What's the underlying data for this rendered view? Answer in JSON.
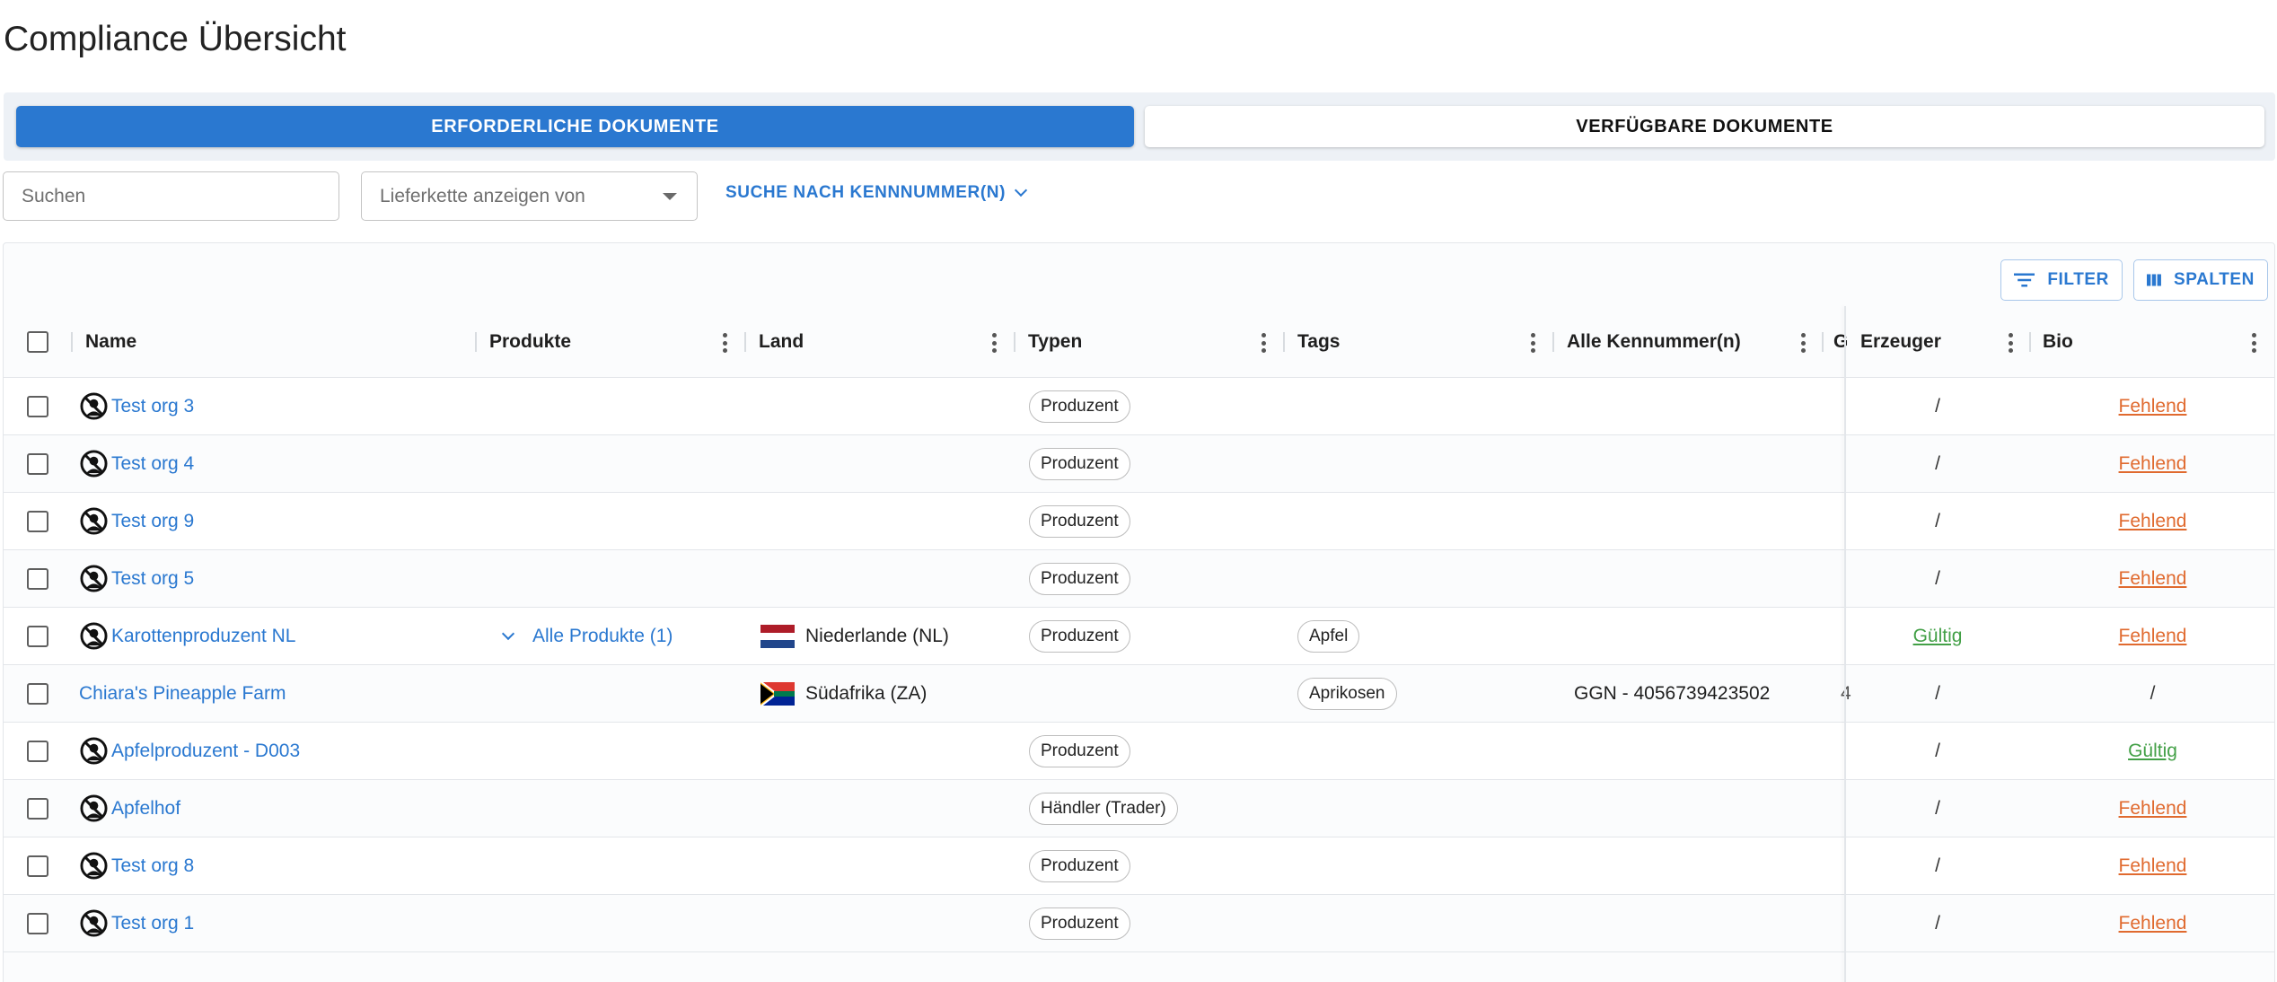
{
  "page": {
    "title": "Compliance Übersicht"
  },
  "tabs": {
    "required": "ERFORDERLICHE DOKUMENTE",
    "available": "VERFÜGBARE DOKUMENTE"
  },
  "filters": {
    "search_placeholder": "Suchen",
    "supply_chain_placeholder": "Lieferkette anzeigen von",
    "id_search_label": "SUCHE NACH KENNNUMMER(N)"
  },
  "toolbar": {
    "filter_label": "FILTER",
    "columns_label": "SPALTEN"
  },
  "columns": {
    "name": "Name",
    "products": "Produkte",
    "country": "Land",
    "types": "Typen",
    "tags": "Tags",
    "ids": "Alle Kennummer(n)",
    "truncated": "G",
    "producer": "Erzeuger",
    "bio": "Bio"
  },
  "colors": {
    "accent": "#2a78d0",
    "missing": "#e06a2f",
    "valid": "#43a047"
  },
  "rows": [
    {
      "name": "Test org 3",
      "icon": "no-sign-icon",
      "products": "",
      "country": "",
      "flag": "",
      "type": "Produzent",
      "tag": "",
      "ids": "",
      "truncated": "",
      "producer": "/",
      "producer_status": "plain",
      "bio": "Fehlend",
      "bio_status": "missing"
    },
    {
      "name": "Test org 4",
      "icon": "no-sign-icon",
      "products": "",
      "country": "",
      "flag": "",
      "type": "Produzent",
      "tag": "",
      "ids": "",
      "truncated": "",
      "producer": "/",
      "producer_status": "plain",
      "bio": "Fehlend",
      "bio_status": "missing"
    },
    {
      "name": "Test org 9",
      "icon": "no-sign-icon",
      "products": "",
      "country": "",
      "flag": "",
      "type": "Produzent",
      "tag": "",
      "ids": "",
      "truncated": "",
      "producer": "/",
      "producer_status": "plain",
      "bio": "Fehlend",
      "bio_status": "missing"
    },
    {
      "name": "Test org 5",
      "icon": "no-sign-icon",
      "products": "",
      "country": "",
      "flag": "",
      "type": "Produzent",
      "tag": "",
      "ids": "",
      "truncated": "",
      "producer": "/",
      "producer_status": "plain",
      "bio": "Fehlend",
      "bio_status": "missing"
    },
    {
      "name": "Karottenproduzent NL",
      "icon": "no-sign-icon",
      "products": "Alle Produkte (1)",
      "country": "Niederlande (NL)",
      "flag": "nl",
      "type": "Produzent",
      "tag": "Apfel",
      "ids": "",
      "truncated": "",
      "producer": "Gültig",
      "producer_status": "valid",
      "bio": "Fehlend",
      "bio_status": "missing"
    },
    {
      "name": "Chiara's Pineapple Farm",
      "icon": "",
      "products": "",
      "country": "Südafrika (ZA)",
      "flag": "za",
      "type": "",
      "tag": "Aprikosen",
      "ids": "GGN - 4056739423502",
      "truncated": "4",
      "producer": "/",
      "producer_status": "plain",
      "bio": "/",
      "bio_status": "plain"
    },
    {
      "name": "Apfelproduzent - D003",
      "icon": "no-sign-icon",
      "products": "",
      "country": "",
      "flag": "",
      "type": "Produzent",
      "tag": "",
      "ids": "",
      "truncated": "",
      "producer": "/",
      "producer_status": "plain",
      "bio": "Gültig",
      "bio_status": "valid"
    },
    {
      "name": "Apfelhof",
      "icon": "no-sign-icon",
      "products": "",
      "country": "",
      "flag": "",
      "type": "Händler (Trader)",
      "tag": "",
      "ids": "",
      "truncated": "",
      "producer": "/",
      "producer_status": "plain",
      "bio": "Fehlend",
      "bio_status": "missing"
    },
    {
      "name": "Test org 8",
      "icon": "no-sign-icon",
      "products": "",
      "country": "",
      "flag": "",
      "type": "Produzent",
      "tag": "",
      "ids": "",
      "truncated": "",
      "producer": "/",
      "producer_status": "plain",
      "bio": "Fehlend",
      "bio_status": "missing"
    },
    {
      "name": "Test org 1",
      "icon": "no-sign-icon",
      "products": "",
      "country": "",
      "flag": "",
      "type": "Produzent",
      "tag": "",
      "ids": "",
      "truncated": "",
      "producer": "/",
      "producer_status": "plain",
      "bio": "Fehlend",
      "bio_status": "missing"
    }
  ]
}
